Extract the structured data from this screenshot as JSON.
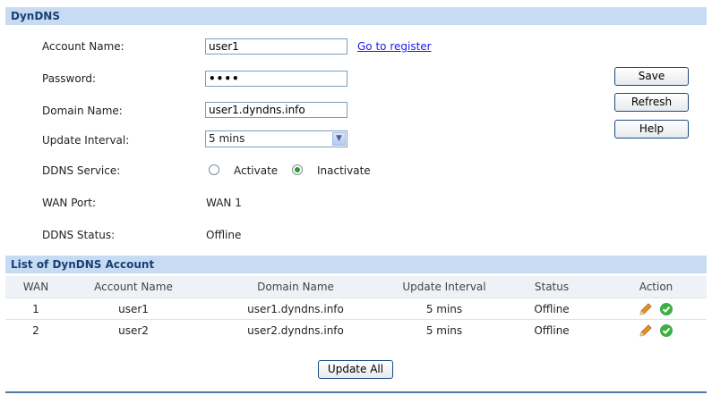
{
  "dyndns": {
    "title": "DynDNS",
    "account_label": "Account Name:",
    "account_value": "user1",
    "register_link": "Go to register",
    "password_label": "Password:",
    "password_value": "••••",
    "domain_label": "Domain Name:",
    "domain_value": "user1.dyndns.info",
    "interval_label": "Update Interval:",
    "interval_value": "5 mins",
    "service_label": "DDNS Service:",
    "activate_label": "Activate",
    "inactivate_label": "Inactivate",
    "service_selected": "Inactivate",
    "wan_port_label": "WAN Port:",
    "wan_port_value": "WAN 1",
    "status_label": "DDNS Status:",
    "status_value": "Offline"
  },
  "buttons": {
    "save": "Save",
    "refresh": "Refresh",
    "help": "Help",
    "update_all": "Update All"
  },
  "list": {
    "title": "List of DynDNS Account",
    "columns": [
      "WAN",
      "Account Name",
      "Domain Name",
      "Update Interval",
      "Status",
      "Action"
    ],
    "rows": [
      {
        "wan": "1",
        "account": "user1",
        "domain": "user1.dyndns.info",
        "interval": "5 mins",
        "status": "Offline"
      },
      {
        "wan": "2",
        "account": "user2",
        "domain": "user2.dyndns.info",
        "interval": "5 mins",
        "status": "Offline"
      }
    ]
  },
  "icons": {
    "edit": "pencil-icon",
    "connect": "check-circle-icon",
    "dropdown": "chevron-down-icon"
  },
  "colors": {
    "header_bg": "#c7dcf3",
    "header_text": "#1a3f73",
    "link": "#1a1aee",
    "check": "#3cb043",
    "pencil": "#e8922c"
  }
}
